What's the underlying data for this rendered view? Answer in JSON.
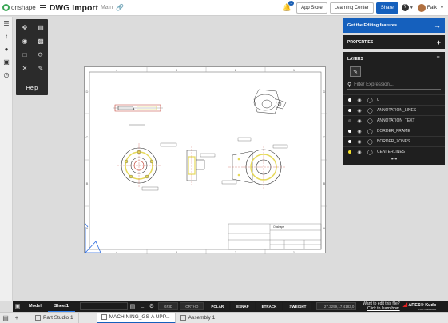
{
  "topbar": {
    "logo_text": "onshape",
    "doc_title": "DWG Import",
    "workspace": "Main",
    "notification_count": "1",
    "app_store": "App Store",
    "learning_center": "Learning Center",
    "share": "Share",
    "user_name": "Falk"
  },
  "left_rail": {
    "icons": [
      "feature-list-icon",
      "variables-icon",
      "comments-icon",
      "parts-icon",
      "history-icon"
    ]
  },
  "palette": {
    "help_label": "Help"
  },
  "sheet": {
    "border_columns": [
      "4",
      "3",
      "2",
      "1"
    ],
    "border_rows": [
      "D",
      "C",
      "B",
      "A"
    ],
    "title_block": {
      "company": "Onshape"
    }
  },
  "right_panel": {
    "editing_banner": "Get the Editing features",
    "properties_title": "PROPERTIES",
    "layers_title": "LAYERS",
    "filter_placeholder": "Filter Expression...",
    "layers": [
      {
        "name": "0",
        "color": "#ffffff"
      },
      {
        "name": "ANNOTATION_LINES",
        "color": "#ffffff"
      },
      {
        "name": "ANNOTATION_TEXT",
        "color": "#555555"
      },
      {
        "name": "BORDER_FRAME",
        "color": "#ffffff"
      },
      {
        "name": "BORDER_ZONES",
        "color": "#ffffff"
      },
      {
        "name": "CENTERLINES",
        "color": "#f5e12a"
      }
    ]
  },
  "bottom_bar": {
    "tabs": [
      "Model",
      "Sheet1"
    ],
    "modes": [
      "GRID",
      "ORTHO",
      "POLAR",
      "ESNAP",
      "ETRACK",
      "SWEIGHT"
    ],
    "coordinates": "27.3299,17.4183,0",
    "edit_prompt": "Want to edit this file?",
    "edit_link": "Click to learn how.",
    "ares_brand": "ARES® Kudo",
    "ares_sub": "FOR ONSHAPE"
  },
  "tabstrip": {
    "tabs": [
      {
        "label": "Part Studio 1",
        "active": false
      },
      {
        "label": "MACHINING_GS-A UPP...",
        "active": true
      },
      {
        "label": "Assembly 1",
        "active": false
      }
    ]
  },
  "colors": {
    "accent": "#1560bd",
    "panel_bg": "#1f1f1f",
    "canvas_bg": "#dcdcdc",
    "drawing_yellow": "#e6d95a",
    "drawing_red": "#c0392b"
  }
}
